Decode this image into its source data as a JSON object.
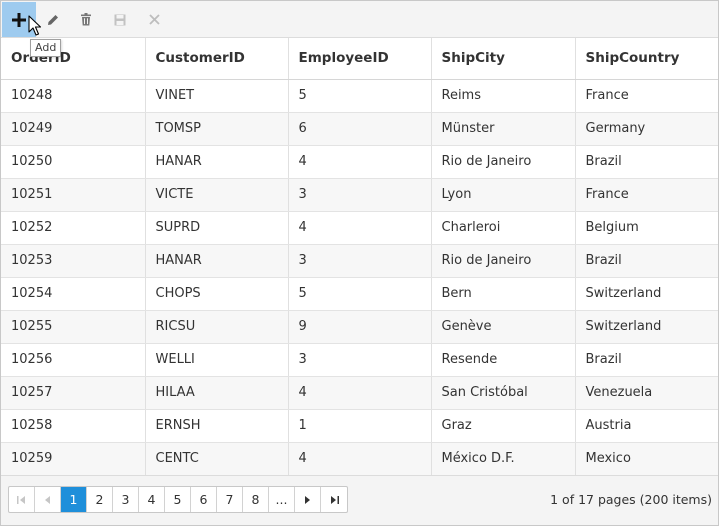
{
  "toolbar": {
    "buttons": [
      "add",
      "edit",
      "delete",
      "update",
      "cancel"
    ],
    "tooltip": "Add"
  },
  "columns": [
    "OrderID",
    "CustomerID",
    "EmployeeID",
    "ShipCity",
    "ShipCountry"
  ],
  "rows": [
    [
      "10248",
      "VINET",
      "5",
      "Reims",
      "France"
    ],
    [
      "10249",
      "TOMSP",
      "6",
      "Münster",
      "Germany"
    ],
    [
      "10250",
      "HANAR",
      "4",
      "Rio de Janeiro",
      "Brazil"
    ],
    [
      "10251",
      "VICTE",
      "3",
      "Lyon",
      "France"
    ],
    [
      "10252",
      "SUPRD",
      "4",
      "Charleroi",
      "Belgium"
    ],
    [
      "10253",
      "HANAR",
      "3",
      "Rio de Janeiro",
      "Brazil"
    ],
    [
      "10254",
      "CHOPS",
      "5",
      "Bern",
      "Switzerland"
    ],
    [
      "10255",
      "RICSU",
      "9",
      "Genève",
      "Switzerland"
    ],
    [
      "10256",
      "WELLI",
      "3",
      "Resende",
      "Brazil"
    ],
    [
      "10257",
      "HILAA",
      "4",
      "San Cristóbal",
      "Venezuela"
    ],
    [
      "10258",
      "ERNSH",
      "1",
      "Graz",
      "Austria"
    ],
    [
      "10259",
      "CENTC",
      "4",
      "México D.F.",
      "Mexico"
    ]
  ],
  "pager": {
    "pages": [
      "1",
      "2",
      "3",
      "4",
      "5",
      "6",
      "7",
      "8",
      "..."
    ],
    "current_page": "1",
    "info": "1 of 17 pages (200 items)"
  },
  "colors": {
    "active_button": "#9ecbef",
    "current_page": "#1f8fda",
    "alt_row": "#f7f7f7"
  }
}
